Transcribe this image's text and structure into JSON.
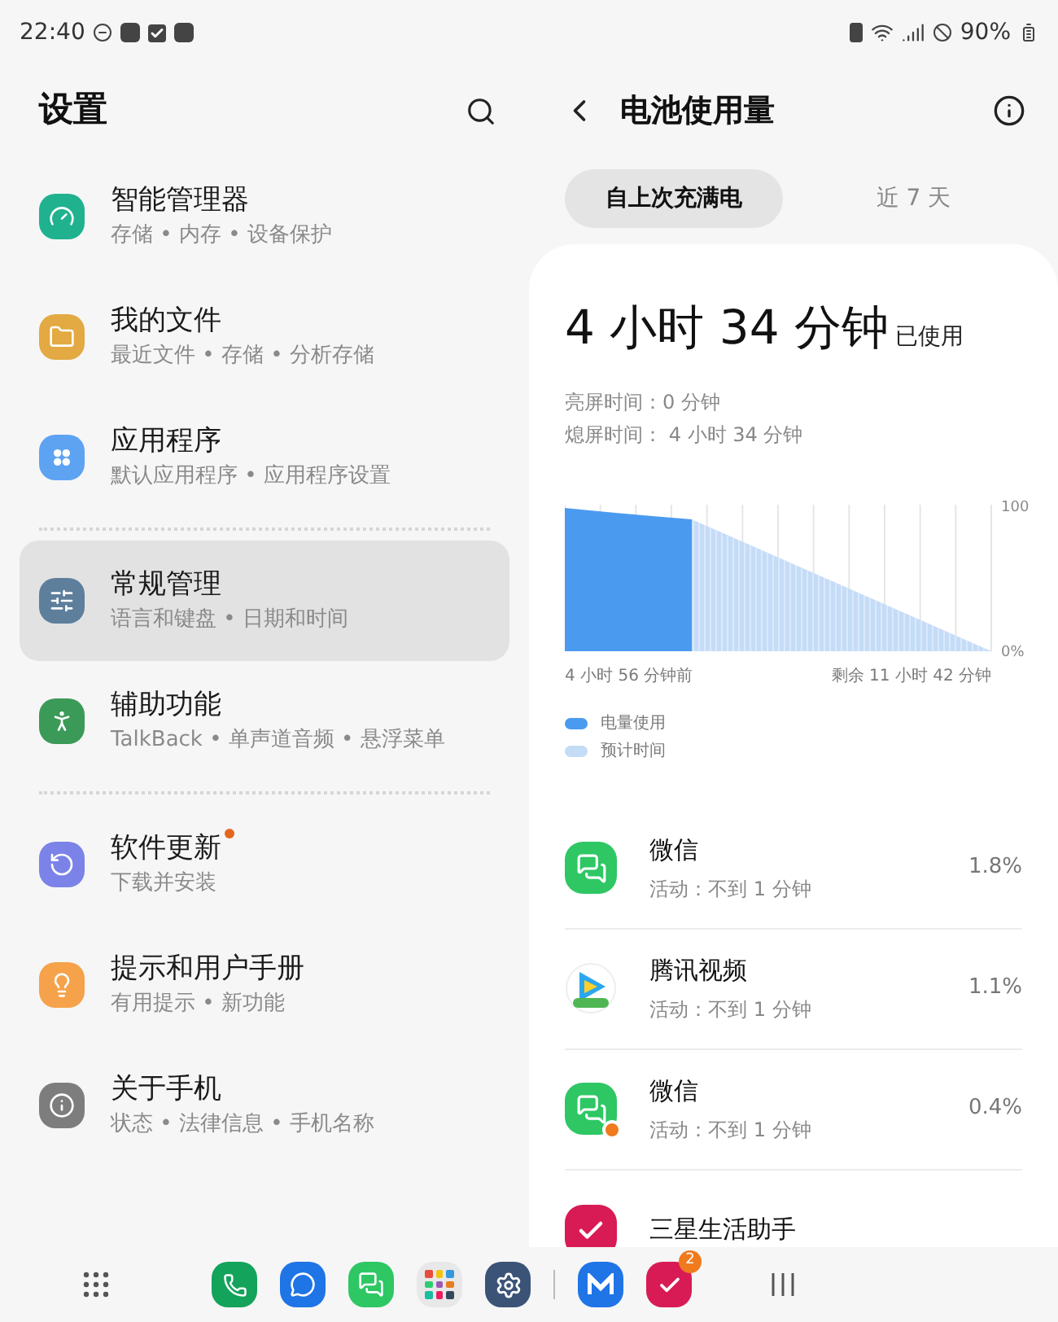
{
  "status_bar": {
    "time": "22:40",
    "battery": "90%"
  },
  "settings": {
    "title": "设置",
    "groups": [
      {
        "items": [
          {
            "title": "智能管理器",
            "subtitle": "存储 • 内存 • 设备保护",
            "color": "#20b28f",
            "selected": false,
            "dot": false
          },
          {
            "title": "我的文件",
            "subtitle": "最近文件 • 存储 • 分析存储",
            "color": "#e3a942",
            "selected": false,
            "dot": false
          },
          {
            "title": "应用程序",
            "subtitle": "默认应用程序 • 应用程序设置",
            "color": "#5ea3f2",
            "selected": false,
            "dot": false
          }
        ]
      },
      {
        "items": [
          {
            "title": "常规管理",
            "subtitle": "语言和键盘 • 日期和时间",
            "color": "#5e7f9c",
            "selected": true,
            "dot": false
          },
          {
            "title": "辅助功能",
            "subtitle": "TalkBack • 单声道音频 • 悬浮菜单",
            "color": "#3b9a57",
            "selected": false,
            "dot": false
          }
        ]
      },
      {
        "items": [
          {
            "title": "软件更新",
            "subtitle": "下载并安装",
            "color": "#7b82e8",
            "selected": false,
            "dot": true
          },
          {
            "title": "提示和用户手册",
            "subtitle": "有用提示 • 新功能",
            "color": "#f5a24a",
            "selected": false,
            "dot": false
          },
          {
            "title": "关于手机",
            "subtitle": "状态 • 法律信息 • 手机名称",
            "color": "#7d7d7d",
            "selected": false,
            "dot": false
          }
        ]
      }
    ]
  },
  "battery": {
    "title": "电池使用量",
    "tabs": [
      {
        "label": "自上次充满电",
        "selected": true
      },
      {
        "label": "近 7 天",
        "selected": false
      }
    ],
    "usage": {
      "value": "4 小时 34 分钟",
      "suffix": "已使用"
    },
    "screen_on": "亮屏时间：0 分钟",
    "screen_off": "熄屏时间： 4 小时 34 分钟",
    "chart": {
      "y_labels": [
        "100",
        "0%"
      ],
      "x_labels": [
        "4 小时 56 分钟前",
        "剩余 11 小时 42 分钟"
      ],
      "legend": [
        {
          "label": "电量使用",
          "color": "#4a9af0"
        },
        {
          "label": "预计时间",
          "color": "#c5dcf7"
        }
      ]
    },
    "apps": [
      {
        "name": "微信",
        "activity": "活动：不到 1 分钟",
        "percent": "1.8%"
      },
      {
        "name": "腾讯视频",
        "activity": "活动：不到 1 分钟",
        "percent": "1.1%"
      },
      {
        "name": "微信",
        "activity": "活动：不到 1 分钟",
        "percent": "0.4%"
      },
      {
        "name": "三星生活助手"
      }
    ]
  },
  "dock": {
    "badge": "2"
  }
}
